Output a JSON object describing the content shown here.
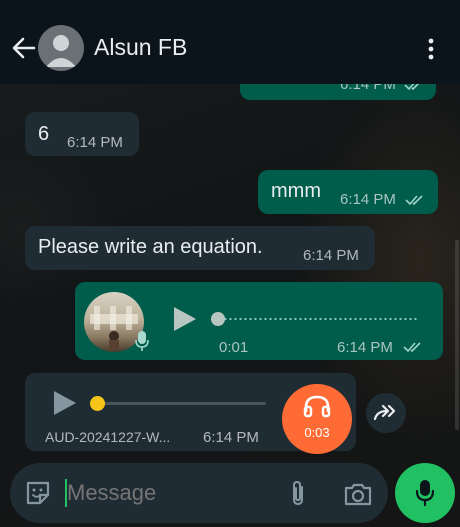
{
  "header": {
    "contact_name": "Alsun FB"
  },
  "messages": [
    {
      "id": "m0",
      "direction": "outgoing",
      "time": "6:14 PM",
      "status": "read"
    },
    {
      "id": "m1",
      "direction": "incoming",
      "text": "6",
      "time": "6:14 PM"
    },
    {
      "id": "m2",
      "direction": "outgoing",
      "text": "mmm",
      "time": "6:14 PM",
      "status": "read"
    },
    {
      "id": "m3",
      "direction": "incoming",
      "text": "Please write an equation.",
      "time": "6:14 PM"
    },
    {
      "id": "m4",
      "direction": "outgoing",
      "type": "voice",
      "duration": "0:01",
      "time": "6:14 PM",
      "status": "read"
    },
    {
      "id": "m5",
      "direction": "incoming",
      "type": "audio",
      "filename": "AUD-20241227-W...",
      "time": "6:14 PM",
      "badge_time": "0:03"
    }
  ],
  "composer": {
    "placeholder": "Message"
  },
  "colors": {
    "header": "#0b141a",
    "incoming_bubble": "#202c33",
    "outgoing_bubble": "#005c4b",
    "accent_green": "#21c063",
    "headphones_orange": "#ff6b35",
    "audio_dot": "#f5c518"
  },
  "icons": [
    "back-arrow-icon",
    "avatar-placeholder-icon",
    "more-vert-icon",
    "play-icon",
    "mic-icon",
    "headphones-icon",
    "forward-icon",
    "sticker-icon",
    "attach-icon",
    "camera-icon",
    "double-check-icon"
  ]
}
